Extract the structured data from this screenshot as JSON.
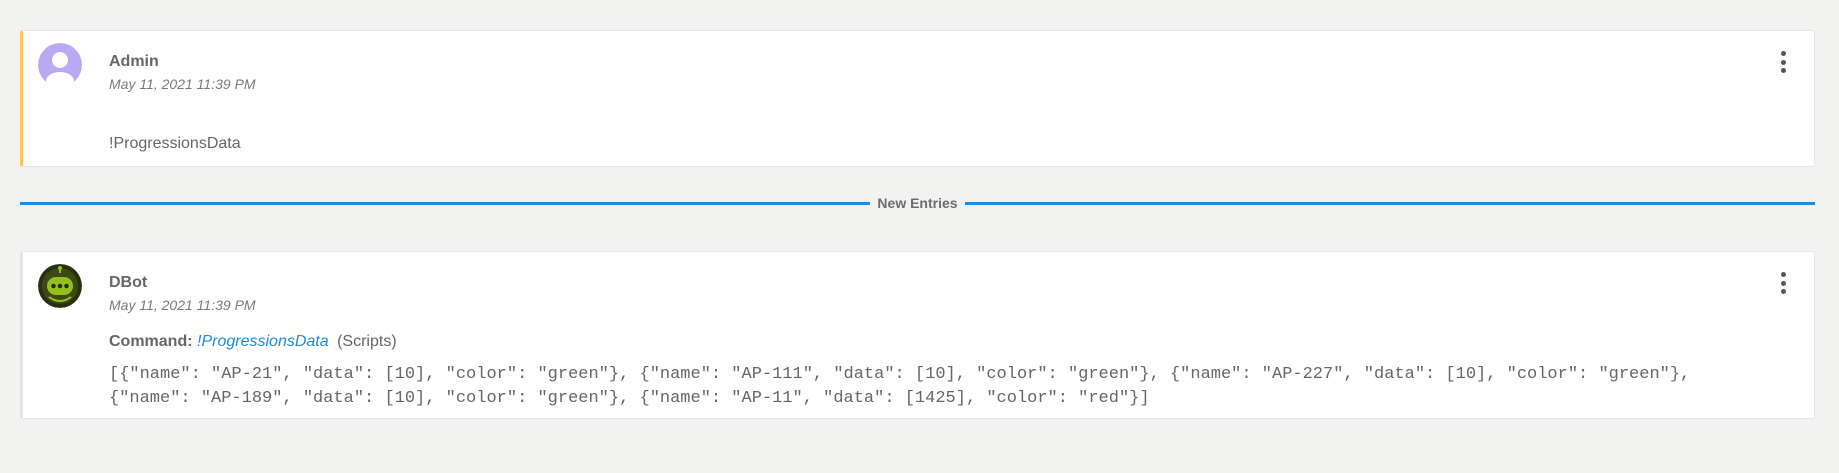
{
  "entries": [
    {
      "author": "Admin",
      "timestamp": "May 11, 2021 11:39 PM",
      "message": "!ProgressionsData",
      "accent_color": "#ffc55e"
    },
    {
      "author": "DBot",
      "timestamp": "May 11, 2021 11:39 PM",
      "command_label": "Command:",
      "command": "!ProgressionsData",
      "command_source": "(Scripts)",
      "output_lines": [
        "[{\"name\": \"AP-21\", \"data\": [10], \"color\": \"green\"}, {\"name\": \"AP-111\", \"data\": [10], \"color\": \"green\"}, {\"name\": \"AP-227\", \"data\": [10], \"color\": \"green\"},",
        "{\"name\": \"AP-189\", \"data\": [10], \"color\": \"green\"}, {\"name\": \"AP-11\", \"data\": [1425], \"color\": \"red\"}]"
      ]
    }
  ],
  "divider": {
    "label": "New Entries",
    "color": "#1f8ad6"
  },
  "icons": {
    "admin_avatar": "user-avatar-icon",
    "dbot_avatar": "dbot-avatar-icon",
    "menu": "kebab-menu-icon"
  }
}
